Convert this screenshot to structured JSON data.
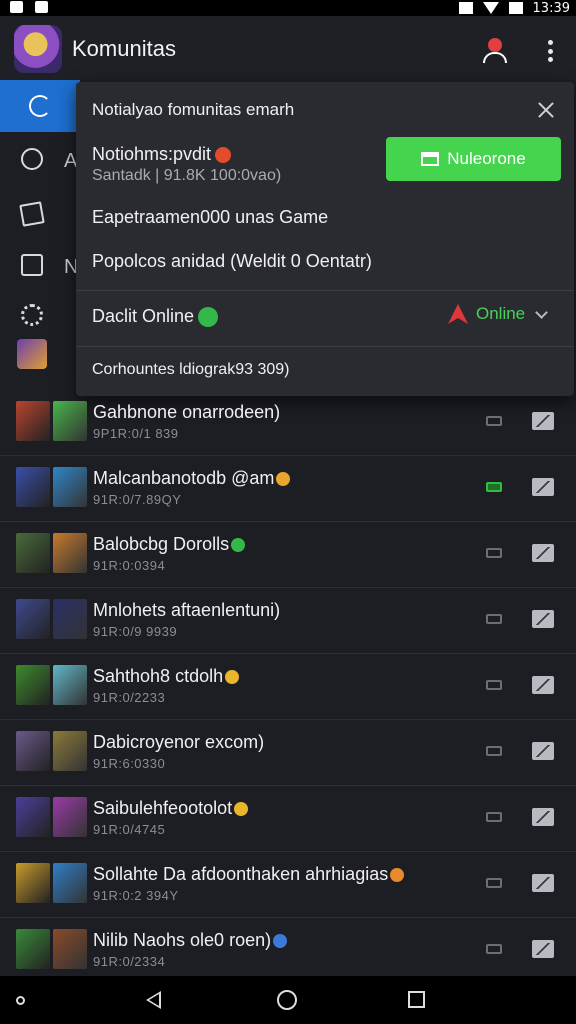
{
  "status_bar": {
    "time": "13:39"
  },
  "app_bar": {
    "title": "Komunitas"
  },
  "background_peek": {
    "item_2_letter": "A",
    "item_4_letter": "N"
  },
  "popup": {
    "header": "Notialyao fomunitas emarh",
    "request_title": "Notiohms:pvdit",
    "request_sub": "Santadk | 91.8K 100:0vao)",
    "accept_label": "Nuleorone",
    "line_game": "Eapetraamen000 unas Game",
    "line_popular": "Popolcos anidad (Weldit 0 Oentatr)",
    "online_title": "Daclit Online",
    "online_status": "Online",
    "footer": "Corhountes ldiograk93 309)"
  },
  "list": [
    {
      "title": "Gahbnone onarrodeen)",
      "sub": "9P1R:0/1 839",
      "badge": "",
      "online": false,
      "thumb_a": "#b8452e",
      "thumb_b": "#48b64a",
      "badge_color": ""
    },
    {
      "title": "Malcanbanotodb @am",
      "sub": "91R:0/7.89QY",
      "badge": "orange",
      "online": true,
      "thumb_a": "#3a4fa8",
      "thumb_b": "#2f86c8",
      "badge_color": "#e9a62a"
    },
    {
      "title": "Balobcbg Dorolls",
      "sub": "91R:0:0394",
      "badge": "green",
      "online": false,
      "thumb_a": "#4a6a3a",
      "thumb_b": "#c77a2a",
      "badge_color": "#33b84a"
    },
    {
      "title": "Mnlohets aftaenlentuni)",
      "sub": "91R:0/9 9939",
      "badge": "",
      "online": false,
      "thumb_a": "#3f4a8f",
      "thumb_b": "#2a3068",
      "badge_color": ""
    },
    {
      "title": "Sahthoh8 ctdolh",
      "sub": "91R:0/2233",
      "badge": "yellow",
      "online": false,
      "thumb_a": "#3e8a2e",
      "thumb_b": "#5fb8c8",
      "badge_color": "#e9b52a"
    },
    {
      "title": "Dabicroyenor excom)",
      "sub": "91R:6:0330",
      "badge": "",
      "online": false,
      "thumb_a": "#6a5a8a",
      "thumb_b": "#8a7a3a",
      "badge_color": ""
    },
    {
      "title": "Saibulehfeootolot",
      "sub": "91R:0/4745",
      "badge": "yellow",
      "online": false,
      "thumb_a": "#4a3f9a",
      "thumb_b": "#9a3aa8",
      "badge_color": "#e9b52a"
    },
    {
      "title": "Sollahte Da afdoonthaken ahrhiagias",
      "sub": "91R:0:2 394Y",
      "badge": "orange",
      "online": false,
      "thumb_a": "#c89a2a",
      "thumb_b": "#2f7ec8",
      "badge_color": "#e98a2a"
    },
    {
      "title": "Nilib Naohs ole0 roen)",
      "sub": "91R:0/2334",
      "badge": "blue",
      "online": false,
      "thumb_a": "#3a8a3a",
      "thumb_b": "#8a4a2a",
      "badge_color": "#3a7ad8"
    }
  ]
}
